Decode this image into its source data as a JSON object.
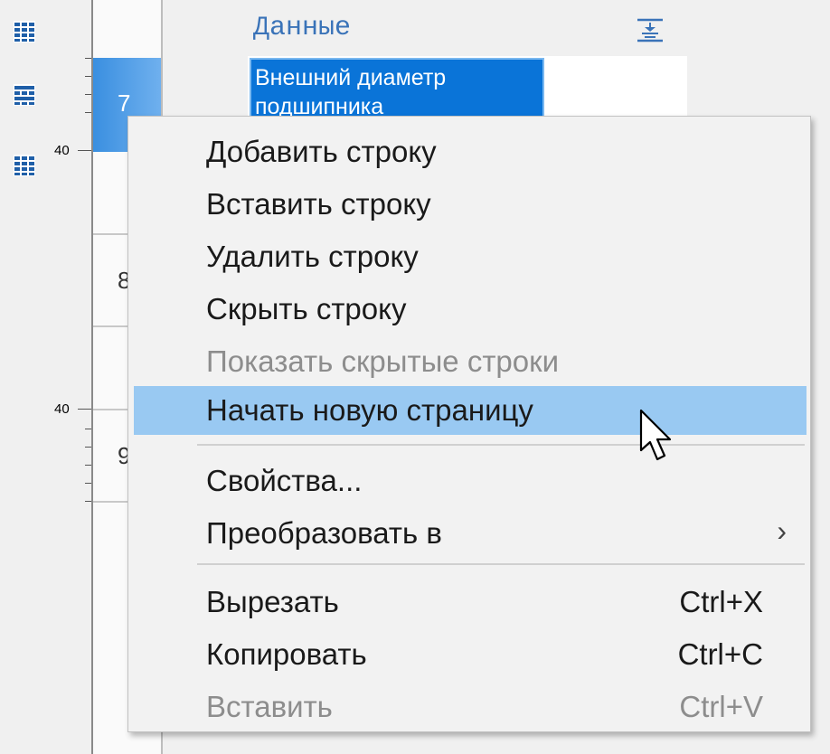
{
  "toolbar": {
    "icons": [
      "table-insert-icon",
      "table-rows-icon",
      "table-grid-icon"
    ]
  },
  "ruler": {
    "labels": [
      "40",
      "40"
    ]
  },
  "rows": [
    {
      "number": "7",
      "selected": true
    },
    {
      "number": "8",
      "selected": false
    },
    {
      "number": "9",
      "selected": false
    }
  ],
  "table": {
    "column_header": "Данные",
    "cell_text": "Внешний диаметр подшипника"
  },
  "context_menu": {
    "items": [
      {
        "label": "Добавить строку",
        "disabled": false
      },
      {
        "label": "Вставить строку",
        "disabled": false
      },
      {
        "label": "Удалить строку",
        "disabled": false
      },
      {
        "label": "Скрыть строку",
        "disabled": false
      },
      {
        "label": "Показать скрытые строки",
        "disabled": true
      },
      {
        "label": "Начать новую страницу",
        "disabled": false,
        "highlighted": true
      },
      {
        "label": "Свойства...",
        "disabled": false
      },
      {
        "label": "Преобразовать в",
        "disabled": false,
        "submenu": true,
        "submenu_glyph": "›"
      },
      {
        "label": "Вырезать",
        "shortcut": "Ctrl+X",
        "disabled": false
      },
      {
        "label": "Копировать",
        "shortcut": "Ctrl+C",
        "disabled": false
      },
      {
        "label": "Вставить",
        "shortcut": "Ctrl+V",
        "disabled": true
      }
    ]
  },
  "colors": {
    "highlight": "#99c9f2",
    "selection": "#0a74d8",
    "header_text": "#3a73b8",
    "disabled_text": "#8d8d8d"
  }
}
